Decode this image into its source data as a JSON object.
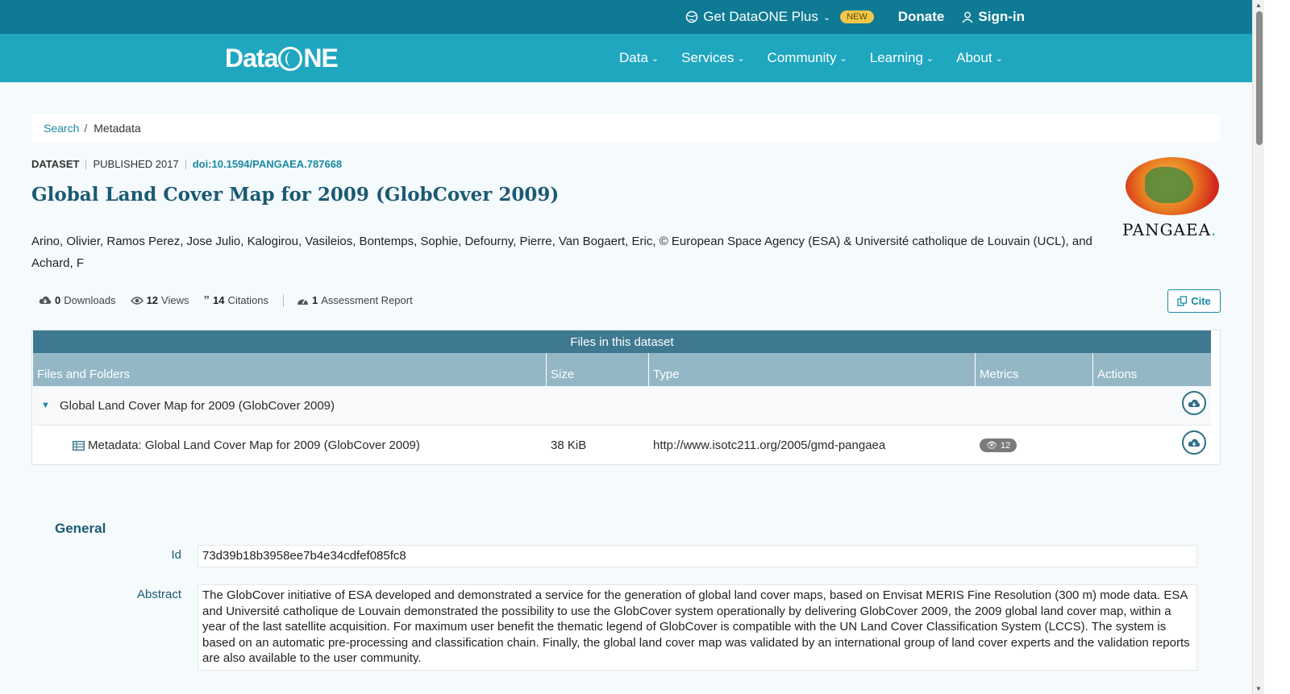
{
  "topbar": {
    "plus_label": "Get DataONE Plus",
    "new_badge": "NEW",
    "donate": "Donate",
    "signin": "Sign-in"
  },
  "nav": {
    "logo_left": "Data",
    "logo_right": "NE",
    "items": [
      {
        "label": "Data"
      },
      {
        "label": "Services"
      },
      {
        "label": "Community"
      },
      {
        "label": "Learning"
      },
      {
        "label": "About"
      }
    ]
  },
  "breadcrumb": {
    "search": "Search",
    "separator": "/",
    "current": "Metadata"
  },
  "dataset": {
    "type": "DATASET",
    "published": "PUBLISHED 2017",
    "doi": "doi:10.1594/PANGAEA.787668",
    "title": "Global Land Cover Map for 2009 (GlobCover 2009)",
    "authors": "Arino, Olivier, Ramos Perez, Jose Julio, Kalogirou, Vasileios, Bontemps, Sophie, Defourny, Pierre, Van Bogaert, Eric, © European Space Agency (ESA) & Université catholique de Louvain (UCL), and Achard, F",
    "repository_logo_text": "PANGAEA",
    "repository_logo_dot": "."
  },
  "stats": {
    "downloads_count": "0",
    "downloads_label": "Downloads",
    "views_count": "12",
    "views_label": "Views",
    "citations_count": "14",
    "citations_label": "Citations",
    "assessment_count": "1",
    "assessment_label": "Assessment Report",
    "cite_button": "Cite"
  },
  "files": {
    "caption": "Files in this dataset",
    "columns": [
      "Files and Folders",
      "Size",
      "Type",
      "Metrics",
      "Actions"
    ],
    "package_row": {
      "name": "Global Land Cover Map for 2009 (GlobCover 2009)"
    },
    "file_row": {
      "name": "Metadata: Global Land Cover Map for 2009 (GlobCover 2009)",
      "size": "38 KiB",
      "type": "http://www.isotc211.org/2005/gmd-pangaea",
      "views": "12"
    }
  },
  "general": {
    "heading": "General",
    "id_label": "Id",
    "id_value": "73d39b18b3958ee7b4e34cdfef085fc8",
    "abstract_label": "Abstract",
    "abstract_value": "The GlobCover initiative of ESA developed and demonstrated a service for the generation of global land cover maps, based on Envisat MERIS Fine Resolution (300 m) mode data. ESA and Université catholique de Louvain demonstrated the possibility to use the GlobCover system operationally by delivering GlobCover 2009, the 2009 global land cover map, within a year of the last satellite acquisition. For maximum user benefit the thematic legend of GlobCover is compatible with the UN Land Cover Classification System (LCCS). The system is based on an automatic pre-processing and classification chain. Finally, the global land cover map was validated by an international group of land cover experts and the validation reports are also available to the user community."
  },
  "colors": {
    "topbar": "#0e7a94",
    "nav": "#1fa7c0",
    "accent": "#1a8aa3",
    "title": "#1b5a73",
    "table_caption": "#3e7991",
    "table_header": "#94b7c5"
  }
}
